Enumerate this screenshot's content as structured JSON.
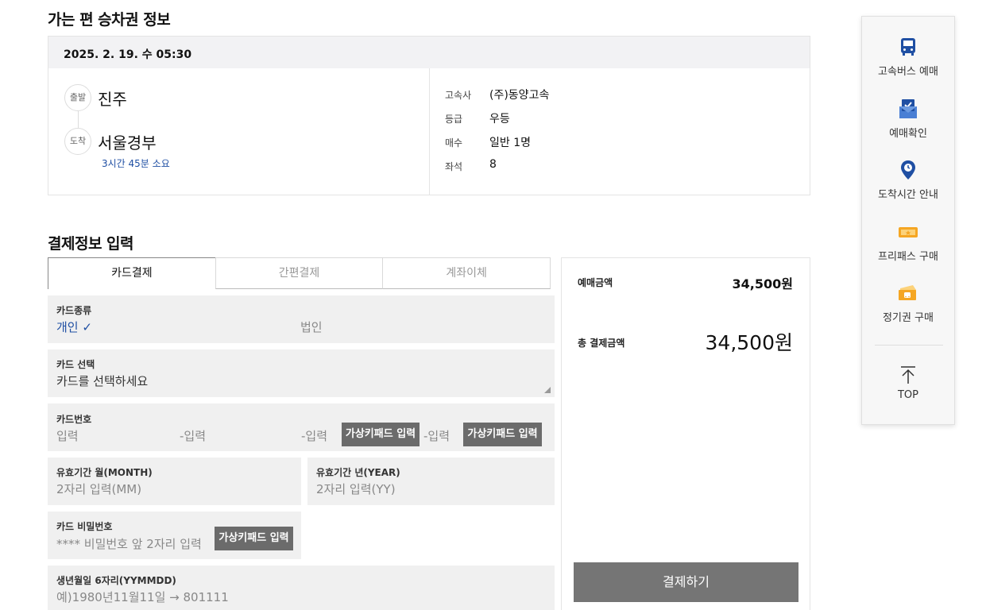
{
  "ticket_section": {
    "title": "가는 편 승차권 정보",
    "datetime": "2025. 2. 19. 수 05:30",
    "departure_badge": "출발",
    "departure": "진주",
    "arrival_badge": "도착",
    "arrival": "서울경부",
    "duration": "3시간 45분 소요",
    "details": [
      {
        "label": "고속사",
        "value": "(주)동양고속"
      },
      {
        "label": "등급",
        "value": "우등"
      },
      {
        "label": "매수",
        "value": "일반 1명"
      },
      {
        "label": "좌석",
        "value": "8"
      }
    ]
  },
  "payment_section": {
    "title": "결제정보 입력",
    "tabs": [
      {
        "label": "카드결제",
        "active": true
      },
      {
        "label": "간편결제",
        "active": false
      },
      {
        "label": "계좌이체",
        "active": false
      }
    ],
    "card_type": {
      "label": "카드종류",
      "personal": "개인 ✓",
      "corporate": "법인"
    },
    "card_select": {
      "label": "카드 선택",
      "value": "카드를 선택하세요"
    },
    "card_number": {
      "label": "카드번호",
      "part1": "입력",
      "part2": "-입력",
      "part3": "-입력",
      "part4": "-입력",
      "keypad_label": "가상키패드 입력"
    },
    "expiry_month": {
      "label": "유효기간 월(MONTH)",
      "placeholder": "2자리 입력(MM)"
    },
    "expiry_year": {
      "label": "유효기간 년(YEAR)",
      "placeholder": "2자리 입력(YY)"
    },
    "card_password": {
      "label": "카드 비밀번호",
      "placeholder": "**** 비밀번호 앞 2자리 입력",
      "keypad_label": "가상키패드 입력"
    },
    "birthdate": {
      "label": "생년월일 6자리(YYMMDD)",
      "placeholder": "예)1980년11월11일 → 801111"
    }
  },
  "summary": {
    "booking_amount_label": "예매금액",
    "booking_amount": "34,500원",
    "total_label": "총 결제금액",
    "total_amount": "34,500원",
    "pay_button": "결제하기"
  },
  "quick_menu": {
    "items": [
      {
        "label": "고속버스 예매",
        "icon": "bus-icon"
      },
      {
        "label": "예매확인",
        "icon": "ticket-check-icon"
      },
      {
        "label": "도착시간 안내",
        "icon": "location-pin-icon"
      },
      {
        "label": "프리패스 구매",
        "icon": "free-pass-icon"
      },
      {
        "label": "정기권 구매",
        "icon": "season-ticket-icon"
      }
    ],
    "top_label": "TOP"
  },
  "colors": {
    "accent_blue": "#1f4fa3",
    "icon_orange": "#f5a623",
    "button_gray": "#757575"
  }
}
